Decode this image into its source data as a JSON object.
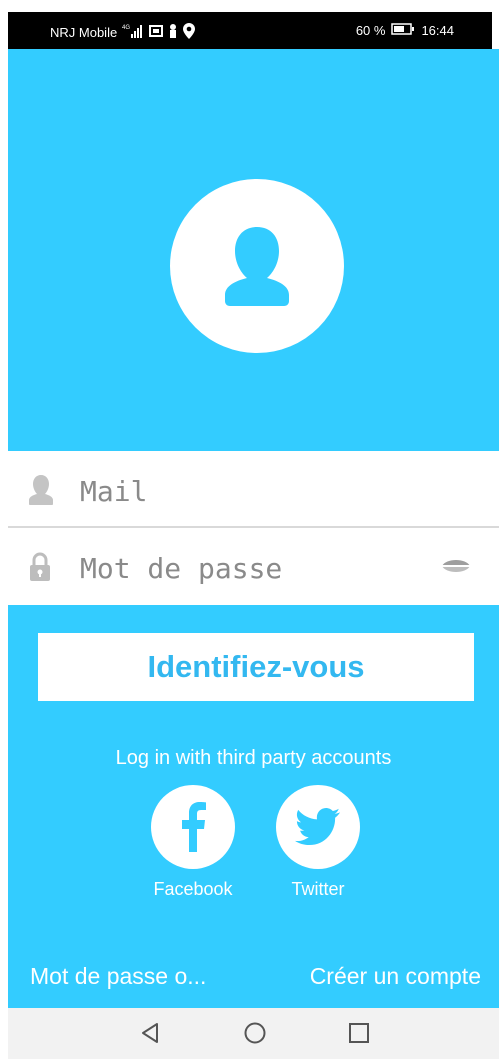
{
  "status_bar": {
    "carrier": "NRJ Mobile",
    "network": "4G",
    "battery": "60 %",
    "time": "16:44"
  },
  "form": {
    "mail_placeholder": "Mail",
    "password_placeholder": "Mot de passe"
  },
  "login_button_label": "Identifiez-vous",
  "third_party_label": "Log in with third party accounts",
  "social": {
    "facebook_label": "Facebook",
    "twitter_label": "Twitter"
  },
  "links": {
    "forgot_password": "Mot de passe o...",
    "create_account": "Créer un compte"
  },
  "colors": {
    "primary": "#33CCFF",
    "button_text": "#33B8F0"
  },
  "icons": {
    "avatar": "user-silhouette-icon",
    "mail_field": "user-icon",
    "password_field": "lock-icon",
    "show_password": "eye-icon",
    "facebook": "facebook-icon",
    "twitter": "twitter-bird-icon",
    "nav_back": "back-triangle-icon",
    "nav_home": "home-circle-icon",
    "nav_recent": "recent-square-icon"
  }
}
